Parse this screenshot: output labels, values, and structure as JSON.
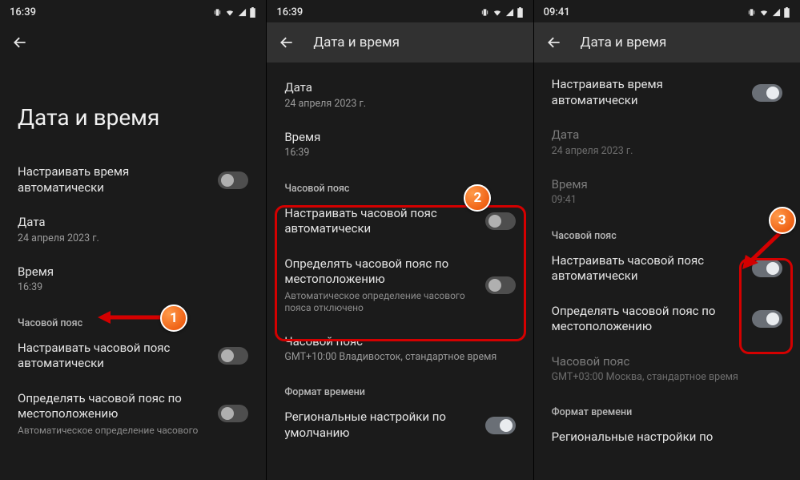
{
  "badges": {
    "b1": "1",
    "b2": "2",
    "b3": "3"
  },
  "screen1": {
    "time": "16:39",
    "largeTitle": "Дата и время",
    "autoTime": "Настраивать время автоматически",
    "dateLabel": "Дата",
    "dateValue": "24 апреля 2023 г.",
    "timeLabel": "Время",
    "timeValue": "16:39",
    "sectionTz": "Часовой пояс",
    "autoTz": "Настраивать часовой пояс автоматически",
    "geoTz": "Определять часовой пояс по местоположению",
    "geoTzSub": "Автоматическое определение часового"
  },
  "screen2": {
    "time": "16:39",
    "appbarTitle": "Дата и время",
    "dateLabel": "Дата",
    "dateValue": "24 апреля 2023 г.",
    "timeLabel": "Время",
    "timeValue": "16:39",
    "sectionTz": "Часовой пояс",
    "autoTz": "Настраивать часовой пояс автоматически",
    "geoTz": "Определять часовой пояс по местоположению",
    "geoTzSub": "Автоматическое определение часового пояса отключено",
    "tzLabel": "Часовой пояс",
    "tzValue": "GMT+10:00 Владивосток, стандартное время",
    "sectionFmt": "Формат времени",
    "regional": "Региональные настройки по умолчанию"
  },
  "screen3": {
    "time": "09:41",
    "appbarTitle": "Дата и время",
    "autoTime": "Настраивать время автоматически",
    "dateLabel": "Дата",
    "dateValue": "24 апреля 2023 г.",
    "timeLabel": "Время",
    "timeValue": "09:41",
    "sectionTz": "Часовой пояс",
    "autoTz": "Настраивать часовой пояс автоматически",
    "geoTz": "Определять часовой пояс по местоположению",
    "tzLabel": "Часовой пояс",
    "tzValue": "GMT+03:00 Москва, стандартное время",
    "sectionFmt": "Формат времени",
    "regional": "Региональные настройки по"
  }
}
